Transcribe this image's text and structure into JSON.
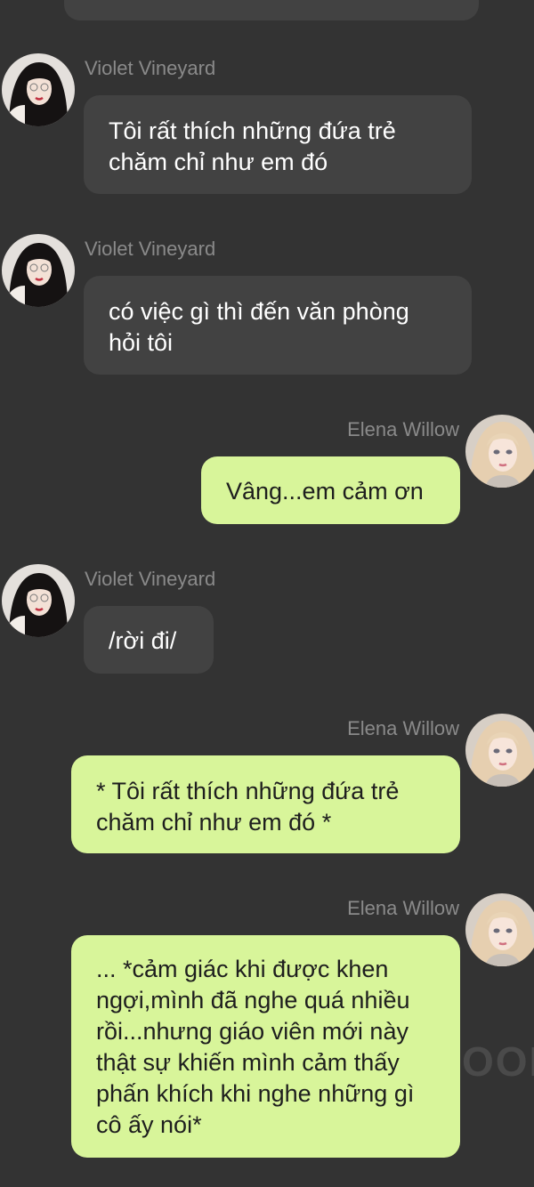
{
  "colors": {
    "background": "#333333",
    "bubble_other": "#424242",
    "bubble_me": "#d8f59a",
    "sender_name": "#8a8a8a"
  },
  "messages": [
    {
      "sender": "Violet Vineyard",
      "side": "other",
      "text": "Tôi rất thích những đứa trẻ\nchăm chỉ như em đó"
    },
    {
      "sender": "Violet Vineyard",
      "side": "other",
      "text": "có việc gì thì đến văn phòng\nhỏi tôi"
    },
    {
      "sender": "Elena Willow",
      "side": "me",
      "text": "Vâng...em cảm ơn"
    },
    {
      "sender": "Violet Vineyard",
      "side": "other",
      "text": "/rời đi/"
    },
    {
      "sender": "Elena Willow",
      "side": "me",
      "text": "* Tôi rất thích những đứa trẻ\nchăm chỉ như em đó *"
    },
    {
      "sender": "Elena Willow",
      "side": "me",
      "text": "... *cảm giác khi được khen\nngợi,mình đã nghe quá nhiều\nrồi...nhưng giáo viên mới này\nthật sự khiến mình cảm thấy\nphấn khích khi nghe những gì\ncô ấy nói*"
    }
  ],
  "watermark": "OON"
}
